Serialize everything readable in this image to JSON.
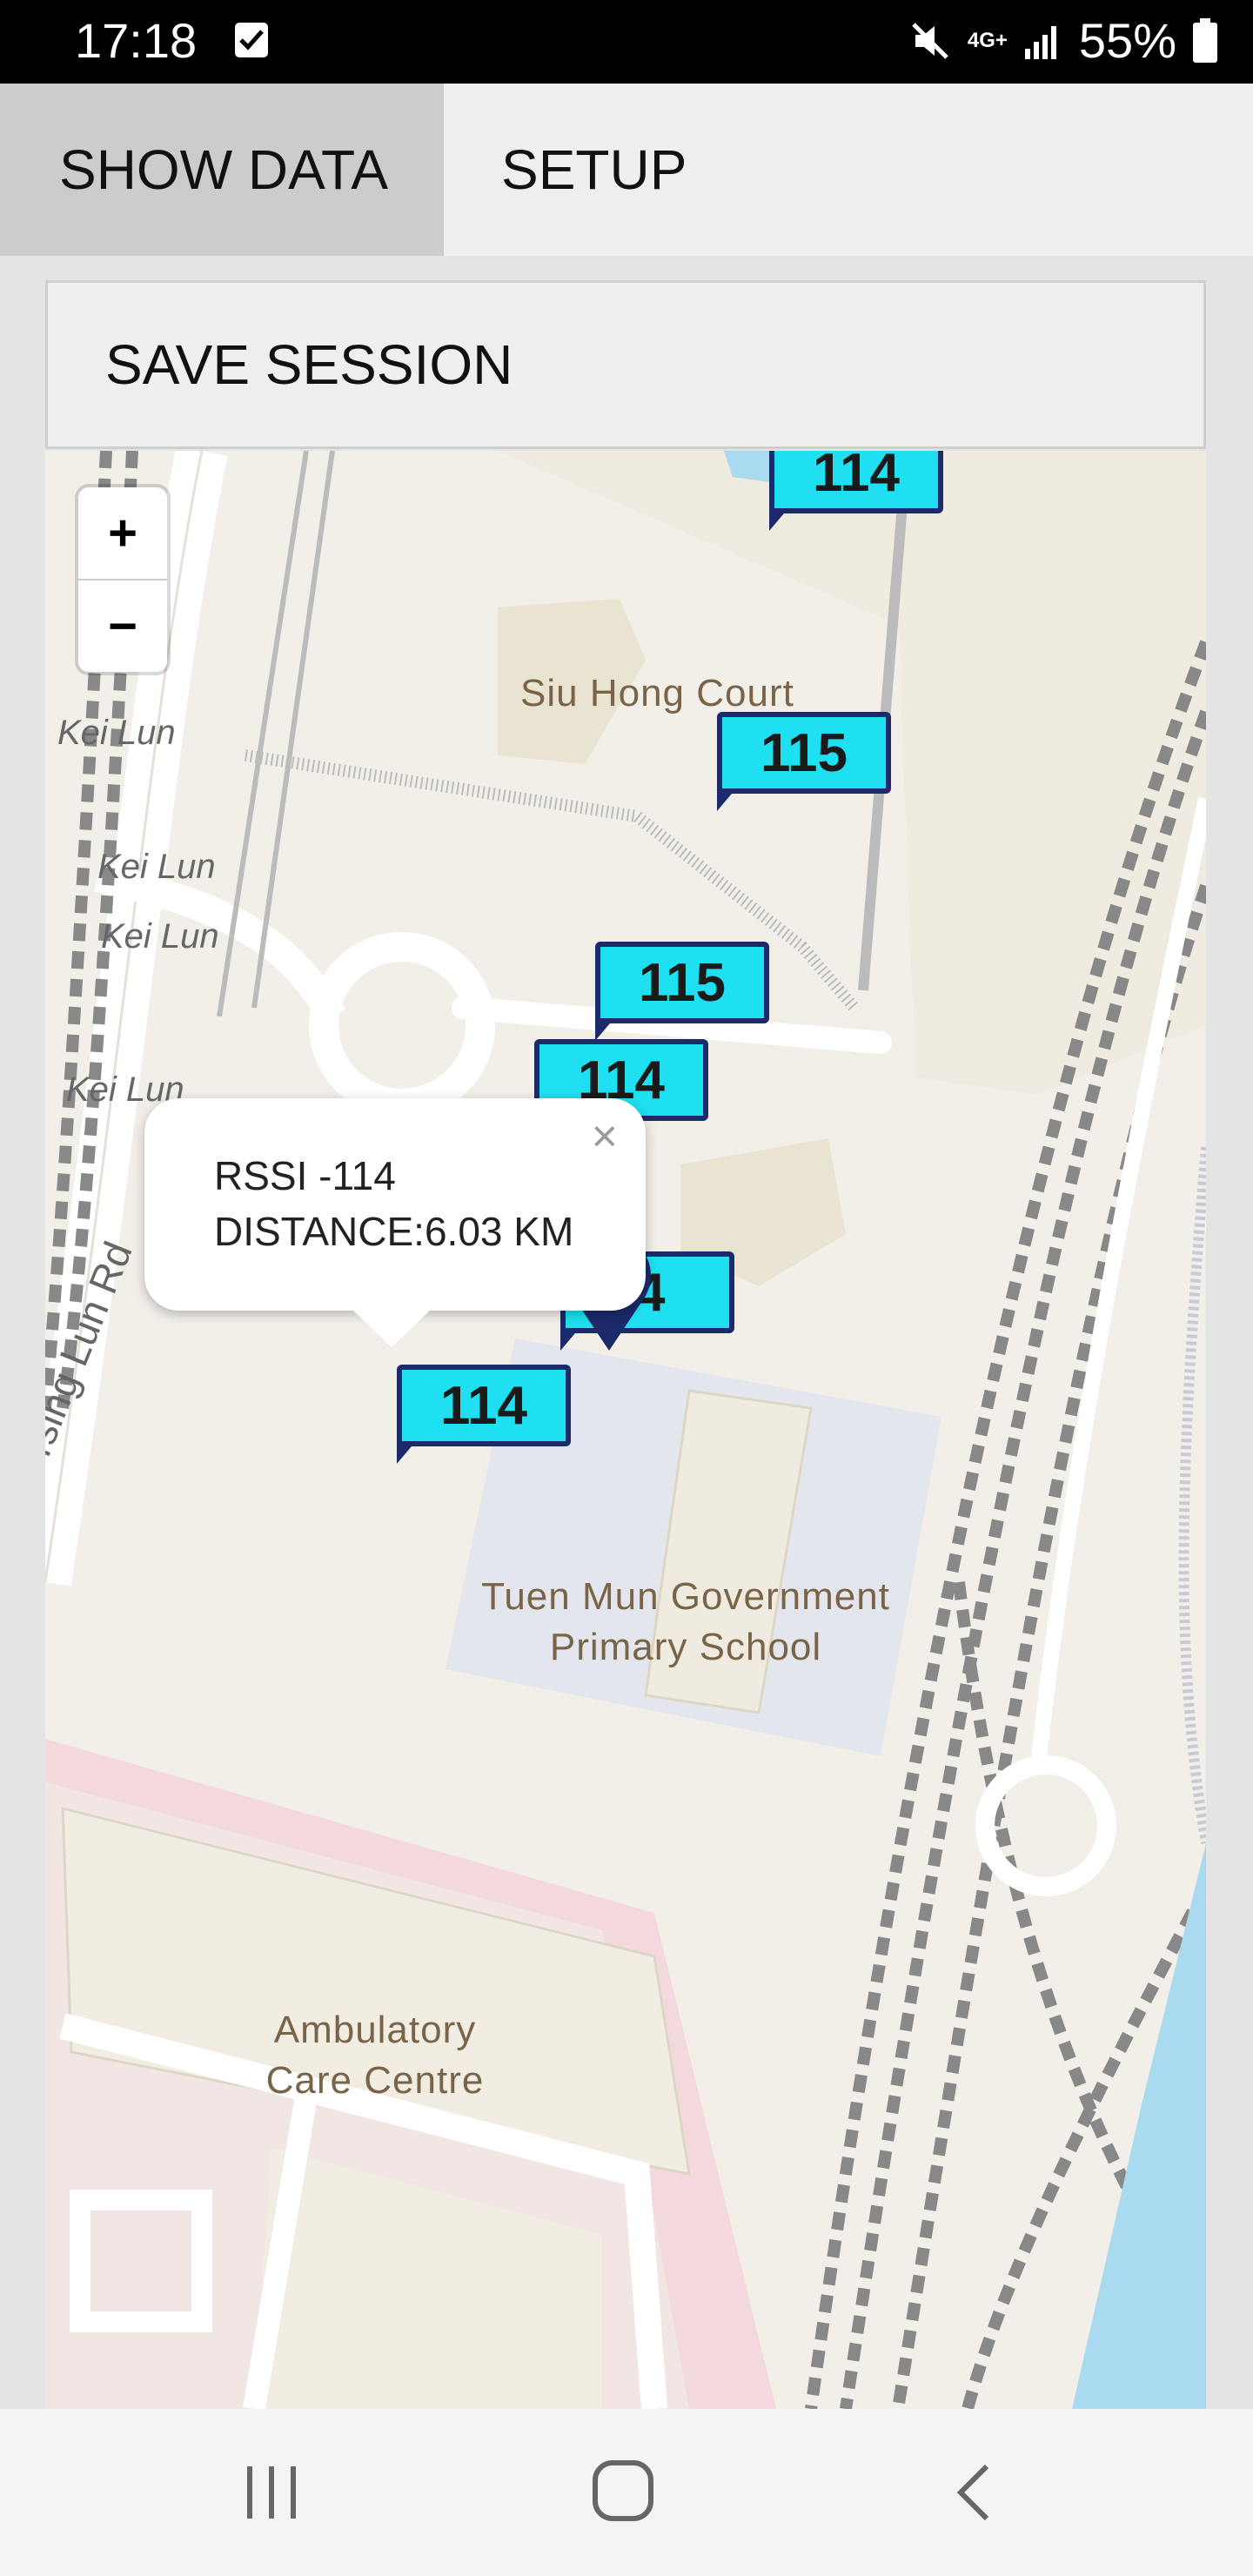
{
  "status_bar": {
    "time": "17:18",
    "network": "4G+",
    "battery": "55%"
  },
  "tabs": [
    {
      "label": "SHOW DATA"
    },
    {
      "label": "SETUP"
    }
  ],
  "save_button": {
    "label": "SAVE SESSION"
  },
  "zoom": {
    "in": "+",
    "out": "−"
  },
  "map_labels": {
    "siu_hong_court": "Siu Hong Court",
    "school": "Tuen Mun Government Primary School",
    "ambulatory": "Ambulatory Care Centre",
    "kei_lun_1": "Kei Lun",
    "kei_lun_2": "Kei Lun",
    "kei_lun_3": "Kei Lun",
    "kei_lun_4": "Kei Lun",
    "tsing_lun_rd": "Tsing Lun Rd"
  },
  "markers": [
    "114",
    "115",
    "115",
    "114",
    "4",
    "114"
  ],
  "popup": {
    "close": "×",
    "rssi": "RSSI -114",
    "distance": "DISTANCE:6.03 KM"
  },
  "colors": {
    "marker_fill": "#1ee0f0",
    "marker_border": "#1b2a6b",
    "water": "#aadaf0"
  },
  "nav_icons": [
    "recent-apps-icon",
    "home-icon",
    "back-icon"
  ]
}
